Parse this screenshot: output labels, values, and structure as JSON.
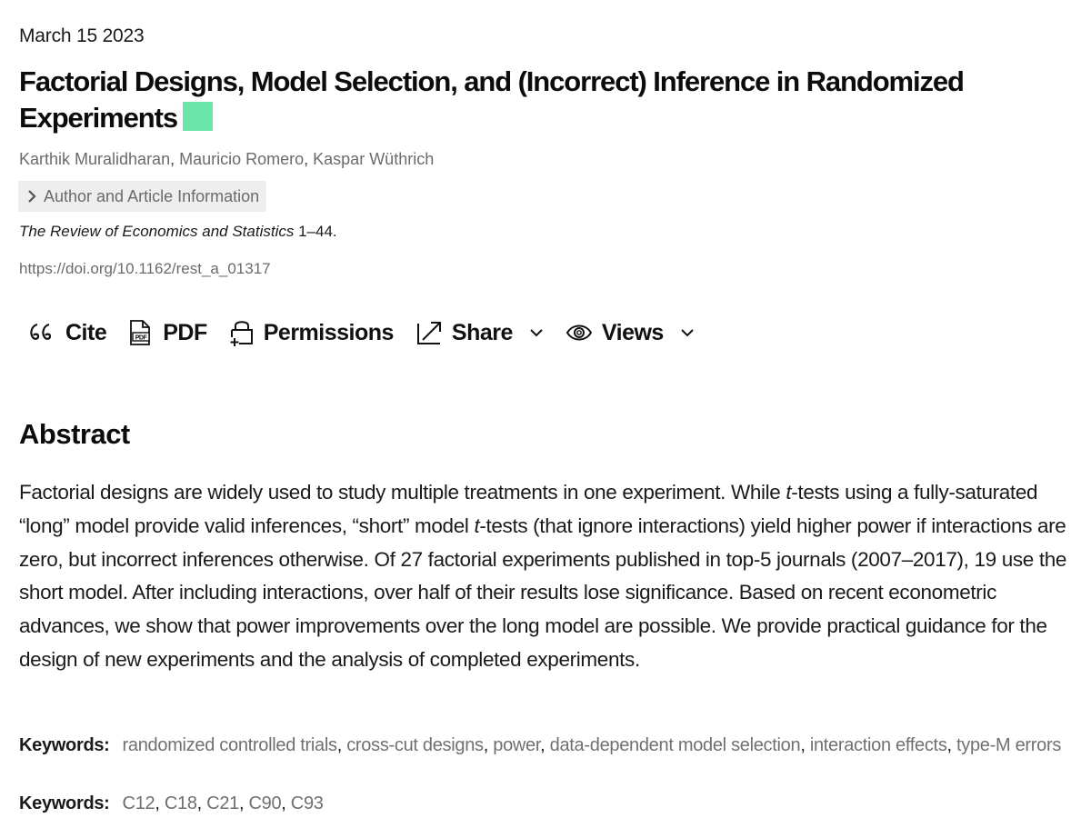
{
  "article": {
    "date": "March 15 2023",
    "title": "Factorial Designs, Model Selection, and (Incorrect) Inference in Randomized Experiments",
    "open_access_badge_color": "#6ce6a8",
    "authors": [
      "Karthik Muralidharan",
      "Mauricio Romero",
      "Kaspar Wüthrich"
    ],
    "author_info_label": "Author and Article Information",
    "journal": "The Review of Economics and Statistics",
    "pages": " 1–44.",
    "doi": "https://doi.org/10.1162/rest_a_01317"
  },
  "toolbar": {
    "cite": "Cite",
    "pdf": "PDF",
    "permissions": "Permissions",
    "share": "Share",
    "views": "Views"
  },
  "abstract": {
    "heading": "Abstract",
    "parts": [
      "Factorial designs are widely used to study multiple treatments in one experiment. While ",
      "t",
      "-tests using a fully-saturated “long” model provide valid inferences, “short” model ",
      "t",
      "-tests (that ignore interactions) yield higher power if interactions are zero, but incorrect inferences otherwise. Of 27 factorial experiments published in top-5 journals (2007–2017), 19 use the short model. After including interactions, over half of their results lose significance. Based on recent econometric advances, we show that power improvements over the long model are possible. We provide practical guidance for the design of new experiments and the analysis of completed experiments."
    ]
  },
  "keywords": {
    "label": "Keywords:",
    "items": [
      "randomized controlled trials",
      "cross-cut designs",
      "power",
      "data-dependent model selection",
      "interaction effects",
      "type-M errors"
    ]
  },
  "jel_codes": {
    "label": "Keywords:",
    "items": [
      "C12",
      "C18",
      "C21",
      "C90",
      "C93"
    ]
  }
}
